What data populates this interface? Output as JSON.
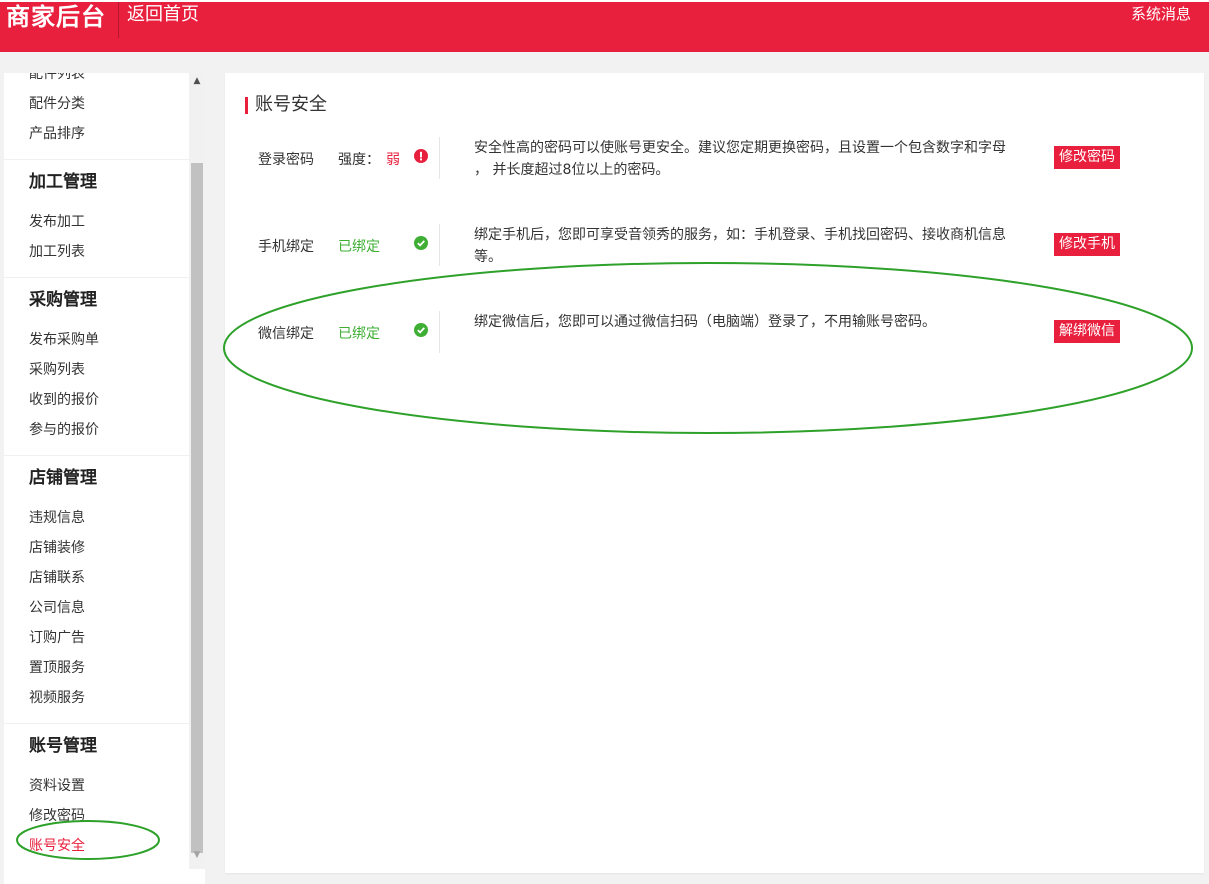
{
  "header": {
    "brand": "商家后台",
    "home_link": "返回首页",
    "system_messages": "系统消息"
  },
  "sidebar": {
    "top_items": [
      "配件列表",
      "配件分类",
      "产品排序"
    ],
    "groups": [
      {
        "title": "加工管理",
        "items": [
          "发布加工",
          "加工列表"
        ]
      },
      {
        "title": "采购管理",
        "items": [
          "发布采购单",
          "采购列表",
          "收到的报价",
          "参与的报价"
        ]
      },
      {
        "title": "店铺管理",
        "items": [
          "违规信息",
          "店铺装修",
          "店铺联系",
          "公司信息",
          "订购广告",
          "置顶服务",
          "视频服务"
        ]
      },
      {
        "title": "账号管理",
        "items": [
          "资料设置",
          "修改密码",
          "账号安全"
        ]
      }
    ],
    "active_item": "账号安全"
  },
  "main": {
    "title": "账号安全",
    "rows": [
      {
        "label": "登录密码",
        "strength_label": "强度：",
        "strength_value": "弱",
        "status_icon": "warning-icon",
        "description": "安全性高的密码可以使账号更安全。建议您定期更换密码，且设置一个包含数字和字母 ， 并长度超过8位以上的密码。",
        "button": "修改密码"
      },
      {
        "label": "手机绑定",
        "status": "已绑定",
        "status_icon": "check-icon",
        "description": "绑定手机后，您即可享受音领秀的服务，如：手机登录、手机找回密码、接收商机信息 等。",
        "button": "修改手机"
      },
      {
        "label": "微信绑定",
        "status": "已绑定",
        "status_icon": "check-icon",
        "description": "绑定微信后，您即可以通过微信扫码（电脑端）登录了，不用输账号密码。",
        "button": "解绑微信"
      }
    ]
  },
  "colors": {
    "brand_red": "#e8203d",
    "success_green": "#3eaf34",
    "annotation_green": "#2ea12a"
  }
}
